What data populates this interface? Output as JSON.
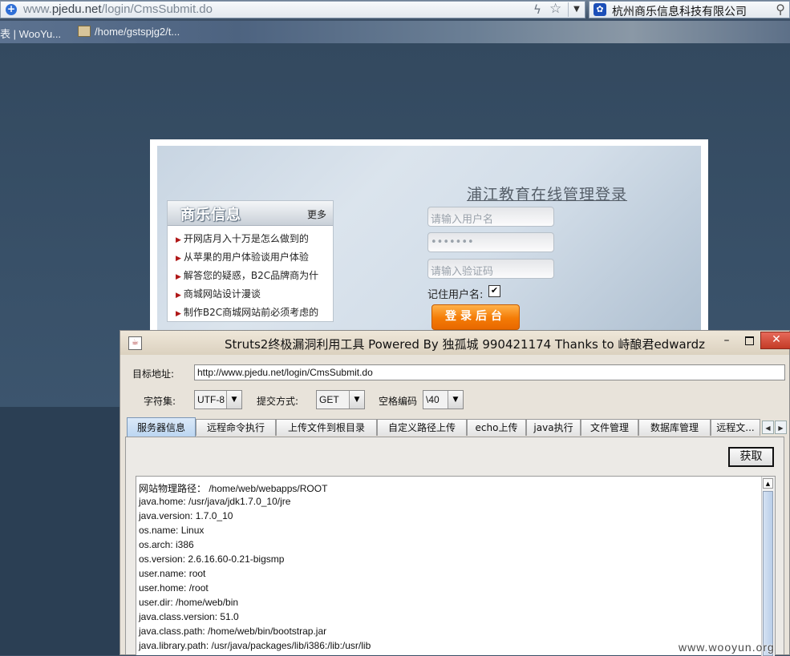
{
  "browser": {
    "url_prefix": "www.",
    "url_domain": "pjedu.net",
    "url_path": "/login/CmsSubmit.do",
    "search_text": "杭州商乐信息科技有限公司",
    "bookmarks": [
      "表 | WooYu...",
      "/home/gstspjg2/t..."
    ]
  },
  "login_page": {
    "title": "浦江教育在线管理登录",
    "news_title": "商乐信息",
    "news_more": "更多",
    "news_items": [
      "开网店月入十万是怎么做到的",
      "从苹果的用户体验谈用户体验",
      "解答您的疑惑，B2C品牌商为什",
      "商城网站设计漫谈",
      "制作B2C商城网站前必须考虑的"
    ],
    "username_placeholder": "请输入用户名",
    "password_value": "•••••••",
    "captcha_placeholder": "请输入验证码",
    "remember_label": "记住用户名:",
    "remember_checked": "✔",
    "login_button": "登录后台"
  },
  "tool": {
    "title": "Struts2终极漏洞利用工具   Powered By 独孤城 990421174 Thanks to 峙酿君edwardz",
    "target_label": "目标地址:",
    "target_value": "http://www.pjedu.net/login/CmsSubmit.do",
    "charset_label": "字符集:",
    "charset_value": "UTF-8",
    "method_label": "提交方式:",
    "method_value": "GET",
    "space_label": "空格编码",
    "space_value": "\\40",
    "tabs": [
      "服务器信息",
      "远程命令执行",
      "上传文件到根目录",
      "自定义路径上传",
      "echo上传",
      "java执行",
      "文件管理",
      "数据库管理",
      "远程文..."
    ],
    "fetch_button": "获取",
    "output_lines": [
      "网站物理路径：  /home/web/webapps/ROOT",
      "java.home: /usr/java/jdk1.7.0_10/jre",
      "java.version: 1.7.0_10",
      "os.name: Linux",
      "os.arch: i386",
      "os.version: 2.6.16.60-0.21-bigsmp",
      "user.name: root",
      "user.home: /root",
      "user.dir: /home/web/bin",
      "java.class.version: 51.0",
      "java.class.path: /home/web/bin/bootstrap.jar",
      "java.library.path: /usr/java/packages/lib/i386:/lib:/usr/lib"
    ]
  },
  "watermark": "www.wooyun.org"
}
